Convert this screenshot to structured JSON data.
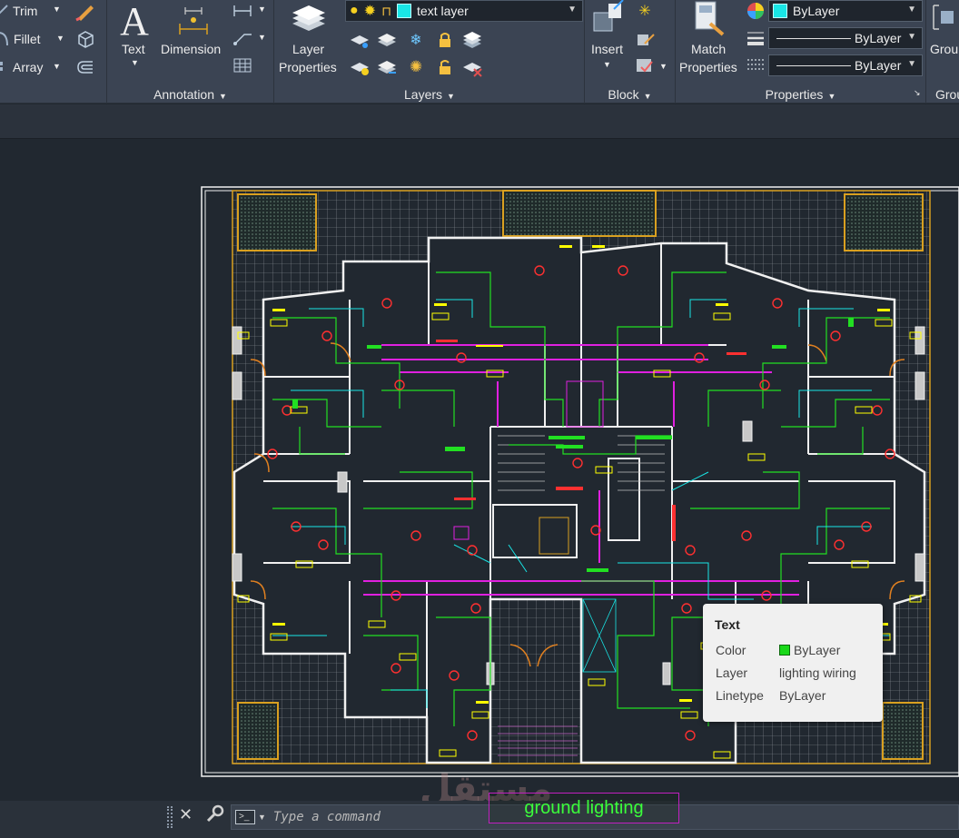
{
  "ribbon": {
    "modify": {
      "trim": "Trim",
      "fillet": "Fillet",
      "array": "Array"
    },
    "annotation": {
      "label": "Annotation",
      "text_button": "Text",
      "dimension_button": "Dimension"
    },
    "layers": {
      "label": "Layers",
      "layer_properties": [
        "Layer",
        "Properties"
      ],
      "current_layer": "text  layer",
      "current_layer_color": "#19e6e6"
    },
    "block": {
      "label": "Block",
      "insert": "Insert"
    },
    "properties": {
      "label": "Properties",
      "match_properties": [
        "Match",
        "Properties"
      ],
      "color": "ByLayer",
      "lineweight": "ByLayer",
      "linetype": "ByLayer"
    },
    "groups": {
      "label": "Grou",
      "group_button": "Grou"
    }
  },
  "tooltip": {
    "title": "Text",
    "rows": [
      {
        "key": "Color",
        "value": "ByLayer",
        "swatch": "#19d819"
      },
      {
        "key": "Layer",
        "value": "lighting wiring"
      },
      {
        "key": "Linetype",
        "value": "ByLayer"
      }
    ]
  },
  "command": {
    "placeholder": "Type a command"
  },
  "drawing": {
    "hover_label": "ground lighting",
    "watermark": "مستقل"
  },
  "colors": {
    "ribbon_bg": "#3b4453",
    "canvas_bg": "#212830",
    "wire_green": "#22e022",
    "wire_cyan": "#19e6e6",
    "wire_magenta": "#e020e0",
    "label_yellow": "#ffff00",
    "wall_white": "#f0f0f0",
    "column_red": "#ff3030",
    "border_orange": "#d9a020"
  }
}
